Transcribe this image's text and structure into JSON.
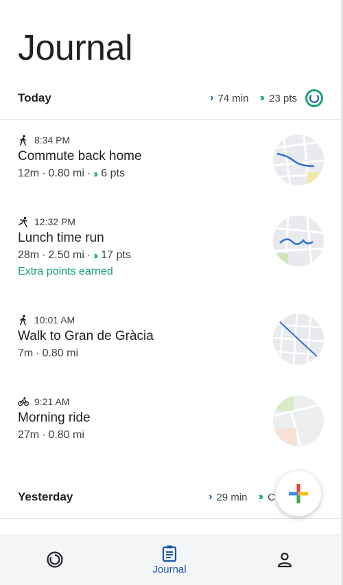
{
  "page": {
    "title": "Journal"
  },
  "sections": [
    {
      "label": "Today",
      "summary": {
        "minutes": "74 min",
        "points": "23 pts"
      }
    },
    {
      "label": "Yesterday",
      "summary": {
        "minutes": "29 min",
        "points": "C"
      }
    }
  ],
  "activities": [
    {
      "time": "8:34 PM",
      "icon": "walk-icon",
      "title": "Commute back home",
      "duration": "12m",
      "distance": "0.80 mi",
      "points": "6 pts",
      "extra": ""
    },
    {
      "time": "12:32 PM",
      "icon": "run-icon",
      "title": "Lunch time run",
      "duration": "28m",
      "distance": "2.50 mi",
      "points": "17 pts",
      "extra": "Extra points earned"
    },
    {
      "time": "10:01 AM",
      "icon": "walk-icon",
      "title": "Walk to Gran de Gràcia",
      "duration": "7m",
      "distance": "0.80 mi",
      "points": "",
      "extra": ""
    },
    {
      "time": "9:21 AM",
      "icon": "bike-icon",
      "title": "Morning ride",
      "duration": "27m",
      "distance": "0.80 mi",
      "points": "",
      "extra": ""
    }
  ],
  "separator": "·",
  "fab": {
    "icon": "plus-icon"
  },
  "nav": [
    {
      "icon": "home-ring-icon",
      "label": ""
    },
    {
      "icon": "journal-icon",
      "label": "Journal"
    },
    {
      "icon": "profile-icon",
      "label": ""
    }
  ],
  "colors": {
    "accent_blue": "#1a56a8",
    "accent_green": "#1aa37a",
    "text": "#202124"
  }
}
